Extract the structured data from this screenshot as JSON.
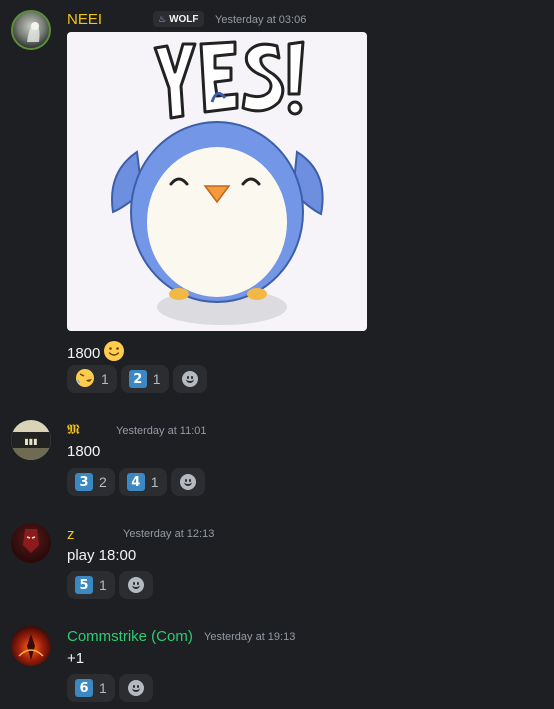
{
  "messages": [
    {
      "author": "NEEI",
      "author_color": "#f0c419",
      "tag": "WOLF",
      "timestamp": "Yesterday at 03:06",
      "attachment": {
        "type": "gif",
        "caption": "YES!"
      },
      "text": "1800",
      "reactions": [
        {
          "emoji": "rolling-on-floor-laughing",
          "count": "1"
        },
        {
          "emoji": "keycap-2",
          "label": "2",
          "count": "1"
        }
      ]
    },
    {
      "author": "𝕸",
      "author_color": "#f0c419",
      "timestamp": "Yesterday at 11:01",
      "text": "1800",
      "reactions": [
        {
          "emoji": "keycap-3",
          "label": "3",
          "count": "2"
        },
        {
          "emoji": "keycap-4",
          "label": "4",
          "count": "1"
        }
      ]
    },
    {
      "author": "z",
      "author_color": "#f0c419",
      "timestamp": "Yesterday at 12:13",
      "text": "play 18:00",
      "reactions": [
        {
          "emoji": "keycap-5",
          "label": "5",
          "count": "1"
        }
      ]
    },
    {
      "author": "Commstrike (Com)",
      "author_color": "#2ecc71",
      "timestamp": "Yesterday at 19:13",
      "text": "+1",
      "reactions": [
        {
          "emoji": "keycap-6",
          "label": "6",
          "count": "1"
        }
      ]
    }
  ]
}
